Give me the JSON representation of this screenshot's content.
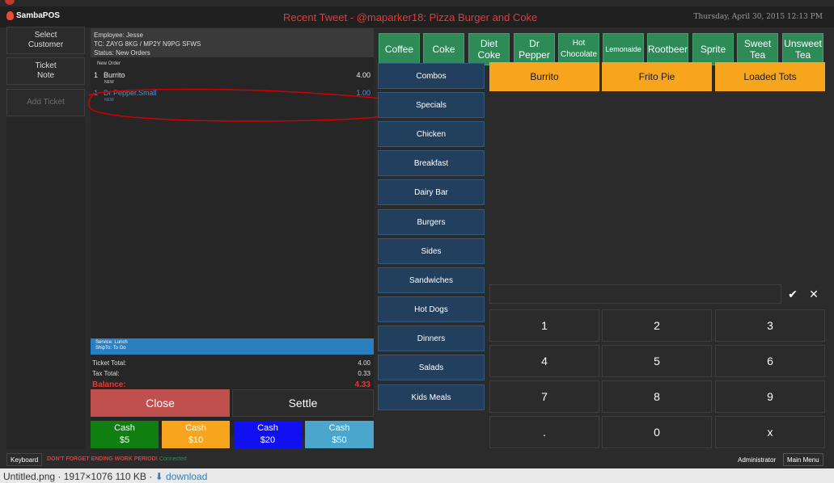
{
  "app": {
    "name": "SambaPOS"
  },
  "header": {
    "tweet": "Recent Tweet - @maparker18:  Pizza Burger and Coke",
    "date": "Thursday, April 30, 2015 12:13 PM"
  },
  "left_buttons": [
    {
      "label": "Select\nCustomer"
    },
    {
      "label": "Ticket\nNote"
    },
    {
      "label": "Add Ticket"
    }
  ],
  "ticket": {
    "employee": "Employee: Jesse",
    "tc": "TC: ZAYG 8KG / MP2Y N9PG SFWS",
    "status": "Status: New Orders",
    "new_order_label": "New Order",
    "lines": [
      {
        "qty": "1",
        "name": "Burrito",
        "price": "4.00",
        "tag": "NEW"
      },
      {
        "qty": "1",
        "name": "Dr Pepper.Small",
        "price": "1.00",
        "tag": "NEW"
      }
    ],
    "service": {
      "line1": "Service: Lunch",
      "line2": "ShipTo: To Go"
    },
    "totals": {
      "ticket_total_label": "Ticket Total:",
      "ticket_total": "4.00",
      "tax_total_label": "Tax Total:",
      "tax_total": "0.33",
      "balance_label": "Balance:",
      "balance": "4.33"
    },
    "close_label": "Close",
    "settle_label": "Settle",
    "cash_buttons": [
      {
        "line1": "Cash",
        "line2": "$5",
        "color": "#0f7f12"
      },
      {
        "line1": "Cash",
        "line2": "$10",
        "color": "#f7a51c"
      },
      {
        "line1": "Cash",
        "line2": "$20",
        "color": "#1010f0"
      },
      {
        "line1": "Cash",
        "line2": "$50",
        "color": "#4aa6cc"
      }
    ]
  },
  "drinks": [
    {
      "label": "Coffee"
    },
    {
      "label": "Coke"
    },
    {
      "label": "Diet\nCoke"
    },
    {
      "label": "Dr\nPepper"
    },
    {
      "label": "Hot\nChocolate"
    },
    {
      "label": "Lemonaide"
    },
    {
      "label": "Rootbeer"
    },
    {
      "label": "Sprite"
    },
    {
      "label": "Sweet\nTea"
    },
    {
      "label": "Unsweet\nTea"
    }
  ],
  "categories": [
    "Combos",
    "Specials",
    "Chicken",
    "Breakfast",
    "Dairy Bar",
    "Burgers",
    "Sides",
    "Sandwiches",
    "Hot Dogs",
    "Dinners",
    "Salads",
    "Kids Meals"
  ],
  "menu_items": [
    "Burrito",
    "Frito Pie",
    "Loaded Tots"
  ],
  "numpad": {
    "keys": [
      "1",
      "2",
      "3",
      "4",
      "5",
      "6",
      "7",
      "8",
      "9",
      ".",
      "0",
      "x"
    ],
    "confirm_icon": "check-icon",
    "clear_icon": "close-icon"
  },
  "footer": {
    "keyboard": "Keyboard",
    "warning": "DON'T FORGET ENDING WORK PERIOD!",
    "connected": "Connected",
    "user": "Administrator",
    "main_menu": "Main Menu"
  },
  "browser_caption": {
    "filename": "Untitled.png",
    "info": "· 1917×1076 110 KB ·",
    "download": "download"
  },
  "colors": {
    "drink_green": "#2e8b57",
    "category_blue": "#22405e",
    "item_orange": "#f7a51c",
    "close_red": "#c0504d",
    "balance_red": "#e53935"
  }
}
